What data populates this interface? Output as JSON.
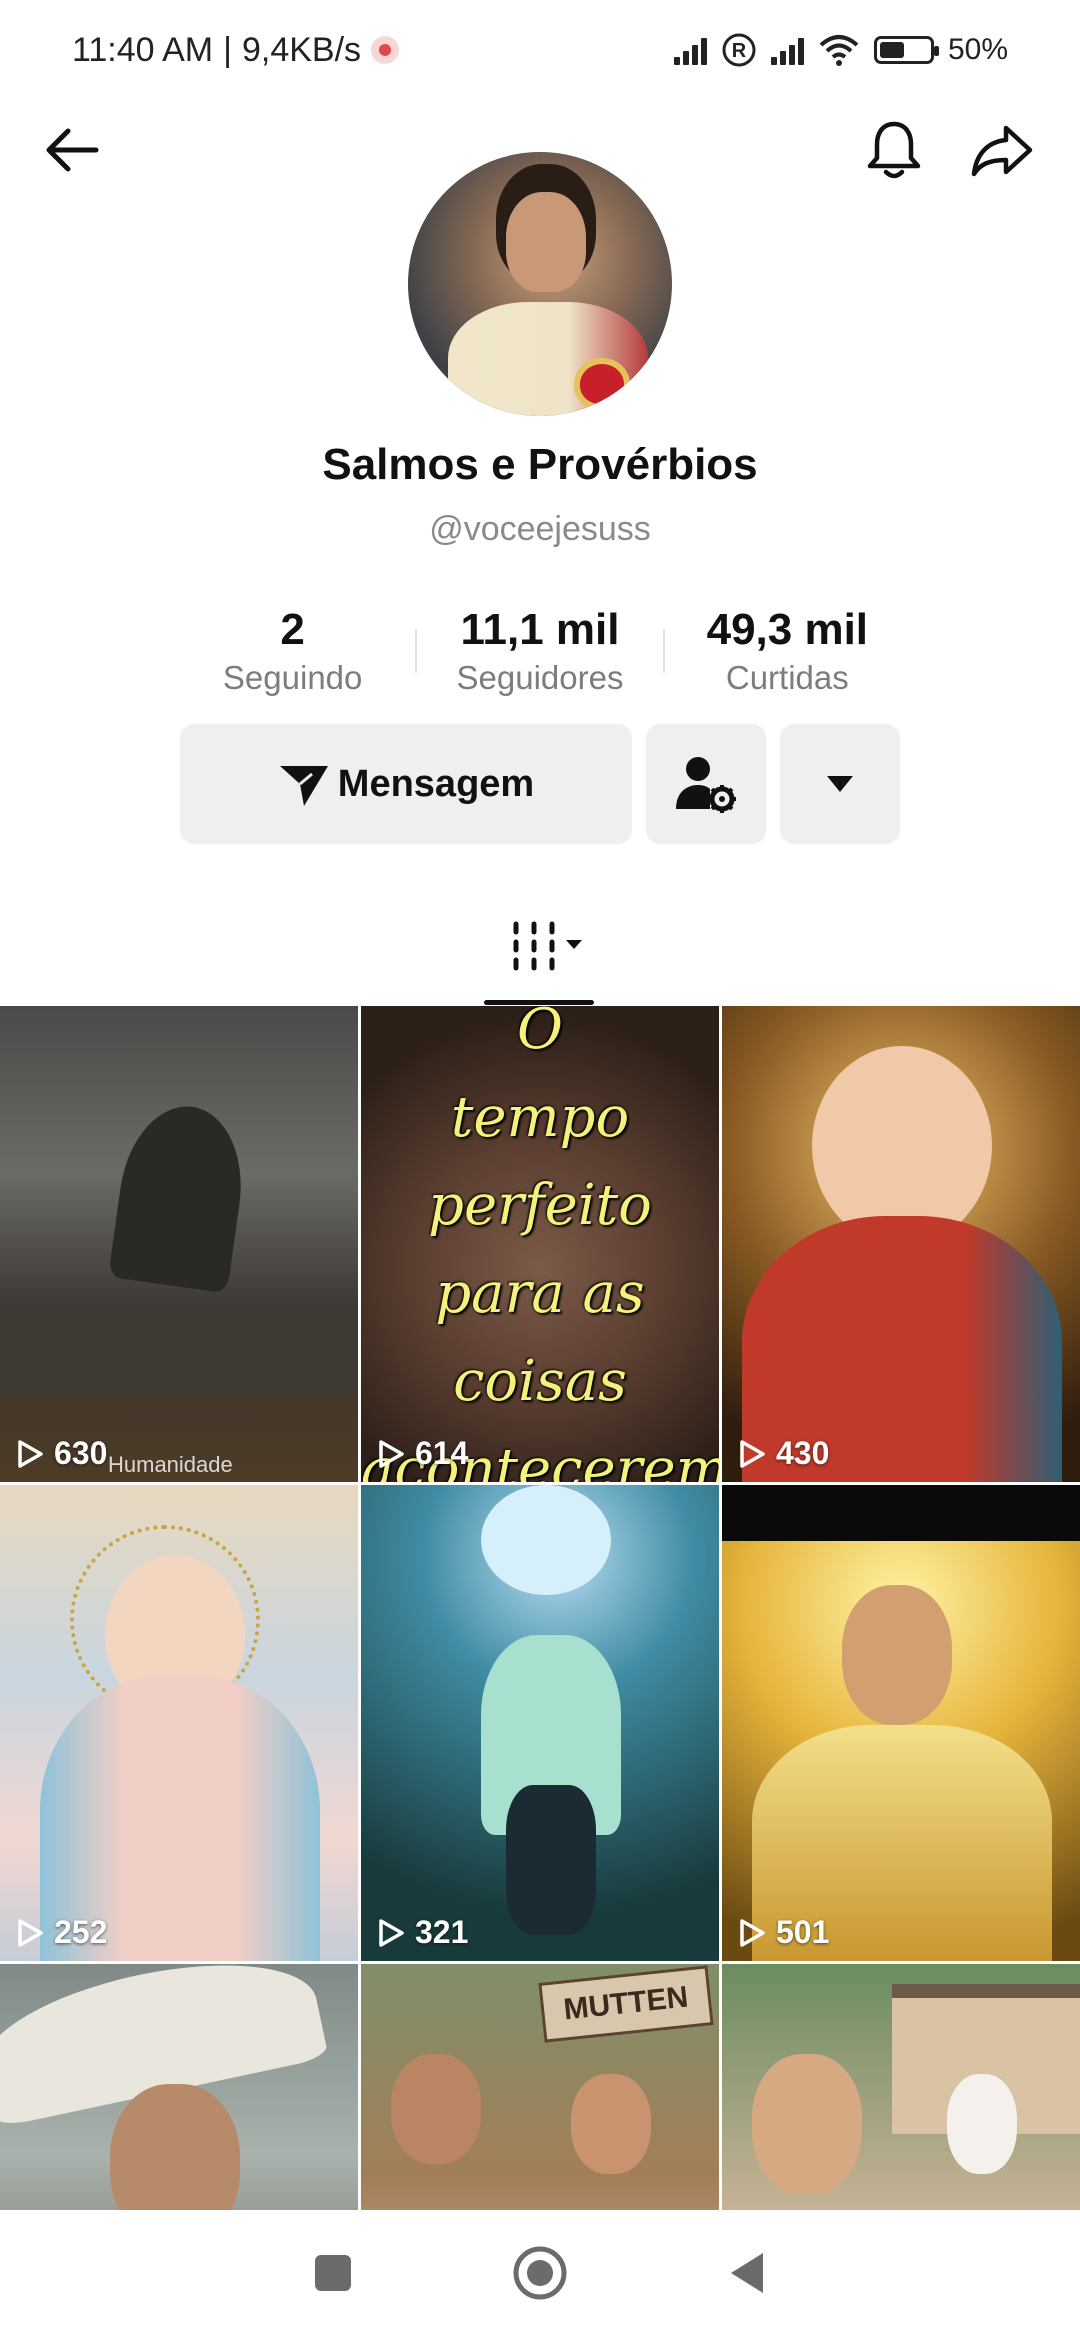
{
  "status_bar": {
    "time": "11:40 AM",
    "separator": "|",
    "speed": "9,4KB/s",
    "battery": "50%",
    "battery_level": 0.5
  },
  "header": {
    "back_icon": "arrow-left-icon",
    "bell_icon": "bell-icon",
    "share_icon": "share-icon"
  },
  "profile": {
    "display_name": "Salmos e Provérbios",
    "username": "@voceejesuss",
    "stats": [
      {
        "value": "2",
        "label": "Seguindo"
      },
      {
        "value": "11,1 mil",
        "label": "Seguidores"
      },
      {
        "value": "49,3 mil",
        "label": "Curtidas"
      }
    ],
    "message_label": "Mensagem"
  },
  "videos": [
    {
      "views": "630",
      "watermark": "Humanidade"
    },
    {
      "views": "614",
      "overlay_lines": [
        "O",
        "tempo",
        "perfeito",
        "para as",
        "coisas",
        "acontecerem"
      ]
    },
    {
      "views": "430"
    },
    {
      "views": "252"
    },
    {
      "views": "321"
    },
    {
      "views": "501"
    },
    {
      "views": ""
    },
    {
      "views": "",
      "sign_text": "MUTTEN"
    },
    {
      "views": ""
    }
  ]
}
